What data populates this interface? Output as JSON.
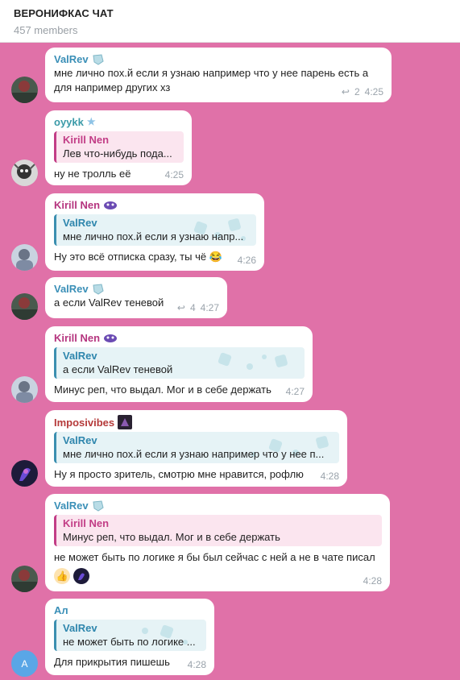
{
  "header": {
    "title": "ВЕРОНИФКАС ЧАТ",
    "subtitle": "457 members"
  },
  "messages": [
    {
      "sender": "ValRev",
      "text1": "мне лично пох.й если я узнаю например что у нее парень есть а",
      "text2": "для например других хз",
      "replies": "2",
      "time": "4:25"
    },
    {
      "sender": "oyykk",
      "reply_name": "Kirill Nen",
      "reply_text": "Лев что-нибудь пода...",
      "text": "ну не тролль её",
      "time": "4:25"
    },
    {
      "sender": "Kirill Nen",
      "reply_name": "ValRev",
      "reply_text": "мне лично пох.й если я узнаю напр...",
      "text": "Ну это всё отписка сразу, ты чё 😂",
      "time": "4:26"
    },
    {
      "sender": "ValRev",
      "text": "а если ValRev теневой",
      "replies": "4",
      "time": "4:27"
    },
    {
      "sender": "Kirill Nen",
      "reply_name": "ValRev",
      "reply_text": "а если ValRev теневой",
      "text": "Минус реп, что выдал. Мог и в себе держать",
      "time": "4:27"
    },
    {
      "sender": "Imposivibes",
      "reply_name": "ValRev",
      "reply_text": "мне лично пох.й если я узнаю например что у нее п...",
      "text": "Ну я просто зритель, смотрю мне нравится, рофлю",
      "time": "4:28"
    },
    {
      "sender": "ValRev",
      "reply_name": "Kirill Nen",
      "reply_text": "Минус реп, что выдал. Мог и в себе держать",
      "text": "не может быть по логике я бы был сейчас с ней а не в чате писал",
      "reaction": "👍",
      "time": "4:28"
    },
    {
      "sender": "Ал",
      "reply_name": "ValRev",
      "reply_text": "не может быть по логике ...",
      "text": "Для прикрытия пишешь",
      "avatar_letter": "А",
      "time": "4:28"
    }
  ]
}
